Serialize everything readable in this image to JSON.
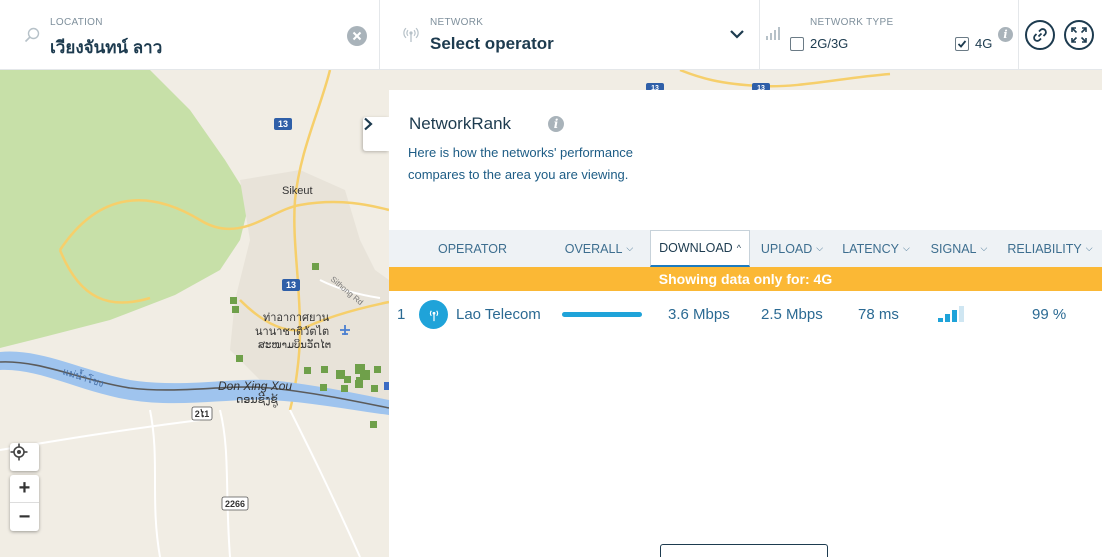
{
  "topbar": {
    "location": {
      "label": "LOCATION",
      "value": "เวียงจันทน์ ลาว"
    },
    "network": {
      "label": "NETWORK",
      "value": "Select operator"
    },
    "network_type": {
      "label": "NETWORK TYPE",
      "options": [
        {
          "label": "2G/3G",
          "checked": false
        },
        {
          "label": "4G",
          "checked": true
        }
      ]
    }
  },
  "map": {
    "labels": {
      "sikeut": "Sikeut",
      "airport_th1": "ท่าอากาศยาน",
      "airport_th2": "นานาชาติวัตไต",
      "airport_lo": "ສະໜາມບິນວັດໄຕ",
      "don_xing_xou": "Don Xing Xou",
      "don_xing_xou_lo": "ດອນຊີງຊູ້",
      "river": "แม่น้ำโขง",
      "sithong": "Sithong Rd"
    },
    "route_shields": [
      "13",
      "13",
      "2ໄ1",
      "2266",
      "13",
      "13"
    ],
    "zoom_in": "+",
    "zoom_out": "−"
  },
  "panel": {
    "title": "NetworkRank",
    "description": "Here is how the networks' performance compares to the area you are viewing.",
    "columns": {
      "operator": "OPERATOR",
      "overall": "OVERALL",
      "download": "DOWNLOAD",
      "upload": "UPLOAD",
      "latency": "LATENCY",
      "signal": "SIGNAL",
      "reliability": "RELIABILITY"
    },
    "banner": "Showing data only for: 4G",
    "rows": [
      {
        "rank": "1",
        "operator": "Lao Telecom",
        "overall_score": 1.0,
        "download": "3.6 Mbps",
        "upload": "2.5 Mbps",
        "latency": "78 ms",
        "signal_bars_filled": 3,
        "signal_bars_total": 4,
        "reliability": "99 %"
      }
    ]
  },
  "colors": {
    "accent": "#1fa3d9",
    "banner": "#fbb835",
    "text_dark": "#1d3b4f",
    "text_link": "#2b6a93"
  }
}
